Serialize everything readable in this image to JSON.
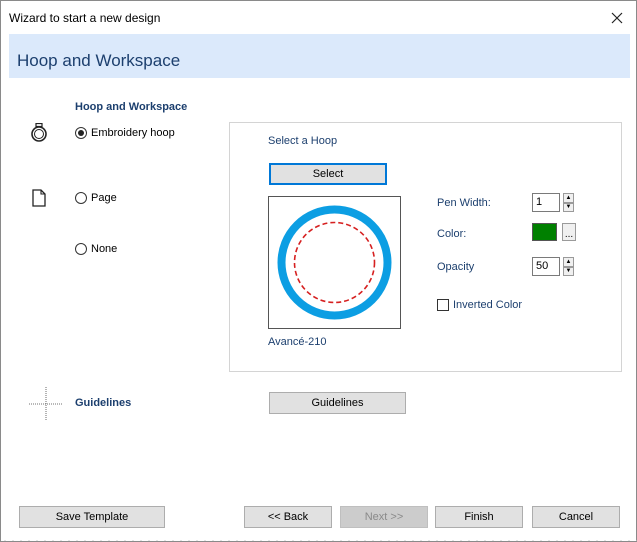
{
  "window": {
    "title": "Wizard to start a new design",
    "close_glyph": "✕"
  },
  "header": {
    "title": "Hoop and Workspace"
  },
  "hoop_section": {
    "label": "Hoop and Workspace",
    "options": [
      {
        "label": "Embroidery hoop",
        "selected": true,
        "icon": "hoop-icon"
      },
      {
        "label": "Page",
        "selected": false,
        "icon": "page-icon"
      },
      {
        "label": "None",
        "selected": false,
        "icon": ""
      }
    ]
  },
  "hoop_group": {
    "select_label": "Select a Hoop",
    "select_button": "Select",
    "hoop_name": "Avancé-210",
    "pen_width_label": "Pen Width:",
    "pen_width_value": "1",
    "color_label": "Color:",
    "color_value": "#008000",
    "color_button": "...",
    "opacity_label": "Opacity",
    "opacity_value": "50",
    "inverted_label": "Inverted Color",
    "inverted_checked": false
  },
  "guidelines_section": {
    "label": "Guidelines",
    "button": "Guidelines"
  },
  "footer": {
    "save_template": "Save Template",
    "back": "<< Back",
    "next": "Next >>",
    "finish": "Finish",
    "cancel": "Cancel"
  },
  "colors": {
    "accent": "#0078d7",
    "header_band": "#dbe9fb",
    "heading_text": "#1c3f6e",
    "hoop_ring": "#0c9ee3",
    "hoop_dash": "#d62020"
  }
}
